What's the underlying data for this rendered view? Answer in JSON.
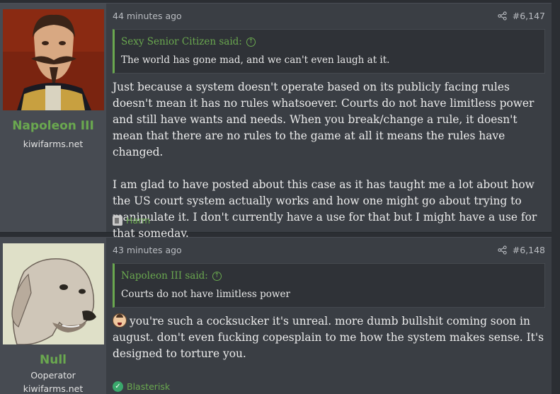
{
  "posts": [
    {
      "username": "Napoleon III",
      "user_title": "",
      "user_site": "kiwifarms.net",
      "time": "44 minutes ago",
      "post_number": "#6,147",
      "quote_author": "Sexy Senior Citizen said:",
      "quote_text": "The world has gone mad, and we can't even laugh at it.",
      "paragraphs": [
        "Just because a system doesn't operate based on its publicly facing rules doesn't mean it has no rules whatsoever. Courts do not have limitless power and still have wants and needs. When you break/change a rule, it doesn't mean that there are no rules to the game at all it means the rules have changed.",
        "I am glad to have posted about this case as it has taught me a lot about how the US court system actually works and how one might go about trying to manipulate it. I don't currently have a use for that but I might have a use for that someday."
      ],
      "reaction_label": "Harm",
      "reaction_icon": "harm-icon"
    },
    {
      "username": "Null",
      "user_title": "Ooperator",
      "user_site": "kiwifarms.net",
      "time": "43 minutes ago",
      "post_number": "#6,148",
      "quote_author": "Napoleon III said:",
      "quote_text": "Courts do not have limitless power",
      "paragraphs": [
        "you're such a cocksucker it's unreal. more dumb bullshit coming soon in august. don't even fucking copesplain to me how the system makes sense. It's designed to torture you."
      ],
      "reaction_label": "Blasterisk",
      "reaction_icon": "check-icon"
    }
  ],
  "colors": {
    "accent": "#6aa84f",
    "background": "#2b2e33",
    "post_bg": "#3a3e44",
    "user_cell_bg": "#474b52"
  }
}
